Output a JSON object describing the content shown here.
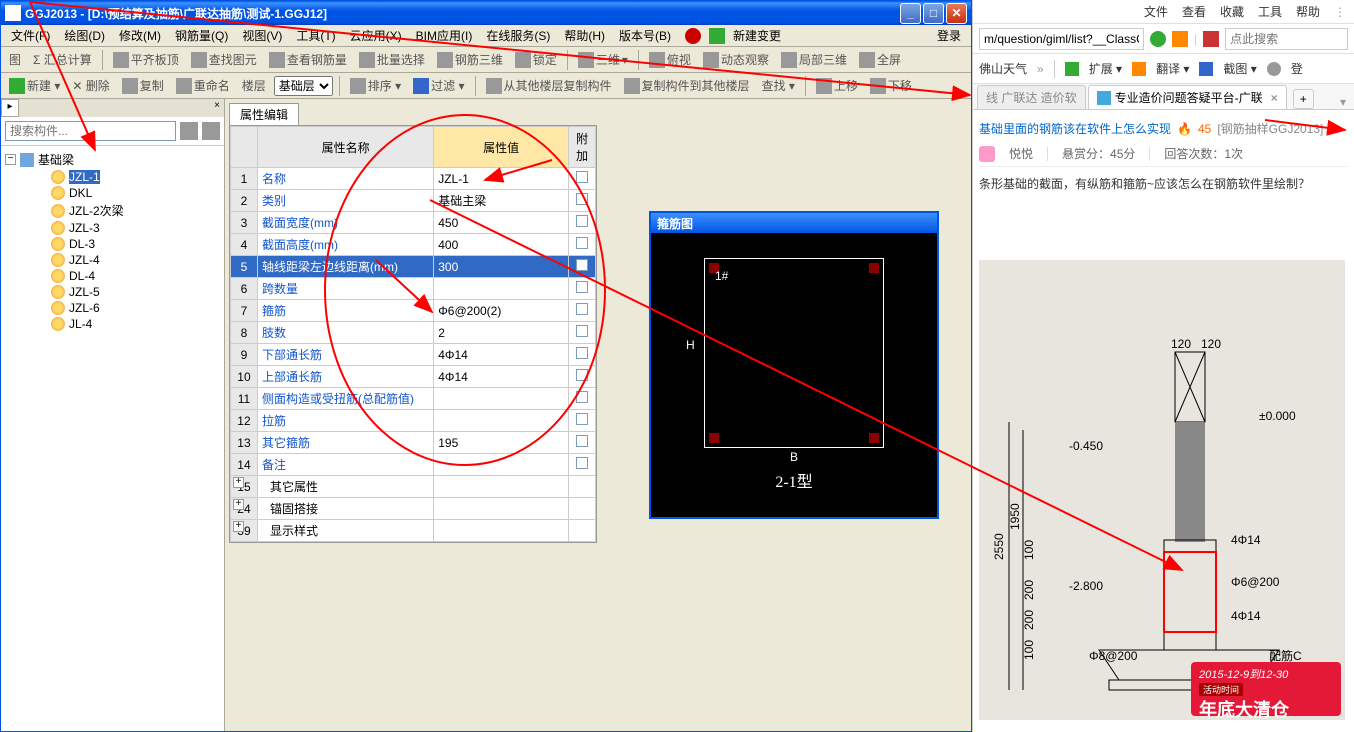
{
  "window": {
    "title": "GGJ2013 - [D:\\预结算及抽筋\\广联达抽筋\\测试-1.GGJ12]",
    "min": "_",
    "max": "□",
    "close": "✕"
  },
  "menubar": [
    "文件(F)",
    "绘图(D)",
    "修改(M)",
    "钢筋量(Q)",
    "视图(V)",
    "工具(T)",
    "云应用(X)",
    "BIM应用(I)",
    "在线服务(S)",
    "帮助(H)",
    "版本号(B)"
  ],
  "menubar_extra": {
    "newchange": "新建变更",
    "login": "登录"
  },
  "toolbar1": [
    "图",
    "Σ 汇总计算",
    "平齐板顶",
    "查找图元",
    "查看钢筋量",
    "批量选择",
    "钢筋三维",
    "锁定",
    "",
    "三维",
    "俯视",
    "动态观察",
    "局部三维",
    "全屏"
  ],
  "toolbar2": {
    "new": "新建 ▾",
    "delete": "✕ 删除",
    "copy": "复制",
    "rename": "重命名",
    "floor": "楼层",
    "layer": "基础层",
    "sort": "排序 ▾",
    "filter": "过滤 ▾",
    "copyfrom": "从其他楼层复制构件",
    "copyto": "复制构件到其他楼层",
    "find": "查找 ▾",
    "up": "上移",
    "down": "下移"
  },
  "search_placeholder": "搜索构件...",
  "tree": {
    "root": "基础梁",
    "items": [
      "JZL-1",
      "DKL",
      "JZL-2次梁",
      "JZL-3",
      "DL-3",
      "JZL-4",
      "DL-4",
      "JZL-5",
      "JZL-6",
      "JL-4"
    ],
    "selected": 0
  },
  "prop_tab": "属性编辑",
  "prop_headers": [
    "",
    "属性名称",
    "属性值",
    "附加"
  ],
  "props": [
    {
      "n": "1",
      "name": "名称",
      "val": "JZL-1",
      "chk": false
    },
    {
      "n": "2",
      "name": "类别",
      "val": "基础主梁",
      "chk": true
    },
    {
      "n": "3",
      "name": "截面宽度(mm)",
      "val": "450",
      "chk": true
    },
    {
      "n": "4",
      "name": "截面高度(mm)",
      "val": "400",
      "chk": true
    },
    {
      "n": "5",
      "name": "轴线距梁左边线距离(mm)",
      "val": "300",
      "chk": true,
      "sel": true
    },
    {
      "n": "6",
      "name": "跨数量",
      "val": "",
      "chk": true
    },
    {
      "n": "7",
      "name": "箍筋",
      "val": "Φ6@200(2)",
      "chk": true
    },
    {
      "n": "8",
      "name": "肢数",
      "val": "2",
      "chk": false
    },
    {
      "n": "9",
      "name": "下部通长筋",
      "val": "4Φ14",
      "chk": true
    },
    {
      "n": "10",
      "name": "上部通长筋",
      "val": "4Φ14",
      "chk": true
    },
    {
      "n": "11",
      "name": "侧面构造或受扭筋(总配筋值)",
      "val": "",
      "chk": true
    },
    {
      "n": "12",
      "name": "拉筋",
      "val": "",
      "chk": false
    },
    {
      "n": "13",
      "name": "其它箍筋",
      "val": "195",
      "chk": false
    },
    {
      "n": "14",
      "name": "备注",
      "val": "",
      "chk": true
    },
    {
      "n": "15",
      "name": "其它属性",
      "val": "",
      "grp": true
    },
    {
      "n": "24",
      "name": "锚固搭接",
      "val": "",
      "grp": true
    },
    {
      "n": "39",
      "name": "显示样式",
      "val": "",
      "grp": true
    }
  ],
  "stirrup": {
    "title": "箍筋图",
    "label_b": "B",
    "label_h": "H",
    "label_no": "1#",
    "caption": "2-1型"
  },
  "browser": {
    "menus": [
      "文件",
      "查看",
      "收藏",
      "工具",
      "帮助"
    ],
    "url": "m/question/giml/list?__ClassCod",
    "url_placeholder": "点此搜索",
    "toolbar": {
      "weather": "佛山天气",
      "ext": "扩展 ▾",
      "trans": "翻译 ▾",
      "shot": "截图 ▾",
      "login": "登"
    },
    "tabs": [
      {
        "label": "线 广联达 造价软",
        "active": false
      },
      {
        "label": "专业造价问题答疑平台-广联",
        "active": true
      }
    ],
    "crumb": {
      "a": "基础里面的钢筋该在软件上怎么实现",
      "hot": "🔥",
      "n": "45",
      "tag": "[钢筋抽样GGJ2013]"
    },
    "meta": {
      "user": "悦悦",
      "bounty": "悬赏分：45分",
      "answers": "回答次数：1次"
    },
    "question": "条形基础的截面，有纵筋和箍筋~应该怎么在钢筋软件里绘制？",
    "promo": {
      "date": "2015-12-9到12-30",
      "sub": "活动时间",
      "big": "年底大清仓"
    },
    "drawing_labels": {
      "d1": "120",
      "d2": "120",
      "e1": "±0.000",
      "e2": "-0.450",
      "e3": "-2.800",
      "r1": "4Φ14",
      "r2": "Φ6@200",
      "r3": "4Φ14",
      "r4": "Φ8@200",
      "dim2550": "2550",
      "dim1950": "1950",
      "dim100a": "100",
      "dim200": "200",
      "dim200b": "200",
      "dim100b": "100",
      "peimian": "配筋C"
    }
  }
}
